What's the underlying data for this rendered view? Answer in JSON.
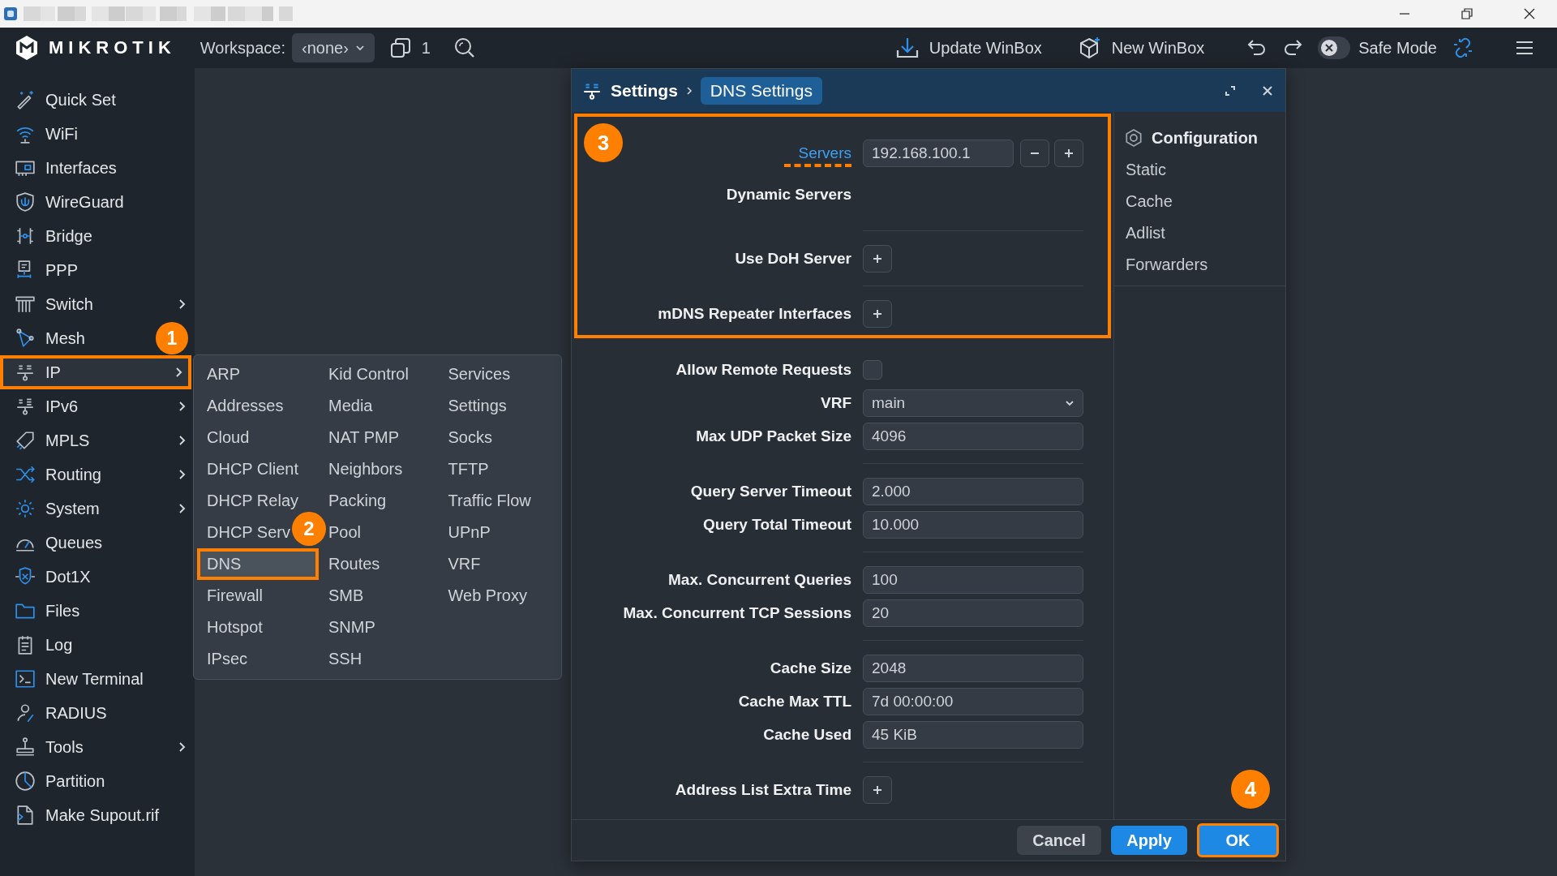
{
  "toolbar": {
    "brand": "MIKROTIK",
    "workspace_label": "Workspace:",
    "workspace_value": "‹none›",
    "window_count": "1",
    "update_button": "Update WinBox",
    "new_button": "New WinBox",
    "safe_mode": {
      "label": "Safe Mode",
      "on": false
    }
  },
  "sidebar": {
    "items": [
      {
        "label": "Quick Set",
        "submenu": false,
        "selected": false
      },
      {
        "label": "WiFi",
        "submenu": false,
        "selected": false
      },
      {
        "label": "Interfaces",
        "submenu": false,
        "selected": false
      },
      {
        "label": "WireGuard",
        "submenu": false,
        "selected": false
      },
      {
        "label": "Bridge",
        "submenu": false,
        "selected": false
      },
      {
        "label": "PPP",
        "submenu": false,
        "selected": false
      },
      {
        "label": "Switch",
        "submenu": true,
        "selected": false
      },
      {
        "label": "Mesh",
        "submenu": false,
        "selected": false
      },
      {
        "label": "IP",
        "submenu": true,
        "selected": true,
        "step": "1"
      },
      {
        "label": "IPv6",
        "submenu": true,
        "selected": false
      },
      {
        "label": "MPLS",
        "submenu": true,
        "selected": false
      },
      {
        "label": "Routing",
        "submenu": true,
        "selected": false
      },
      {
        "label": "System",
        "submenu": true,
        "selected": false
      },
      {
        "label": "Queues",
        "submenu": false,
        "selected": false
      },
      {
        "label": "Dot1X",
        "submenu": false,
        "selected": false
      },
      {
        "label": "Files",
        "submenu": false,
        "selected": false
      },
      {
        "label": "Log",
        "submenu": false,
        "selected": false
      },
      {
        "label": "New Terminal",
        "submenu": false,
        "selected": false
      },
      {
        "label": "RADIUS",
        "submenu": false,
        "selected": false
      },
      {
        "label": "Tools",
        "submenu": true,
        "selected": false
      },
      {
        "label": "Partition",
        "submenu": false,
        "selected": false
      },
      {
        "label": "Make Supout.rif",
        "submenu": false,
        "selected": false
      }
    ]
  },
  "menu": {
    "columns": [
      [
        {
          "label": "ARP",
          "selected": false
        },
        {
          "label": "Addresses",
          "selected": false
        },
        {
          "label": "Cloud",
          "selected": false
        },
        {
          "label": "DHCP Client",
          "selected": false
        },
        {
          "label": "DHCP Relay",
          "selected": false
        },
        {
          "label": "DHCP Serv",
          "selected": false
        },
        {
          "label": "DNS",
          "selected": true,
          "step": "2"
        },
        {
          "label": "Firewall",
          "selected": false
        },
        {
          "label": "Hotspot",
          "selected": false
        },
        {
          "label": "IPsec",
          "selected": false
        }
      ],
      [
        {
          "label": "Kid Control",
          "selected": false
        },
        {
          "label": "Media",
          "selected": false
        },
        {
          "label": "NAT PMP",
          "selected": false
        },
        {
          "label": "Neighbors",
          "selected": false
        },
        {
          "label": "Packing",
          "selected": false
        },
        {
          "label": "Pool",
          "selected": false
        },
        {
          "label": "Routes",
          "selected": false
        },
        {
          "label": "SMB",
          "selected": false
        },
        {
          "label": "SNMP",
          "selected": false
        },
        {
          "label": "SSH",
          "selected": false
        }
      ],
      [
        {
          "label": "Services",
          "selected": false
        },
        {
          "label": "Settings",
          "selected": false
        },
        {
          "label": "Socks",
          "selected": false
        },
        {
          "label": "TFTP",
          "selected": false
        },
        {
          "label": "Traffic Flow",
          "selected": false
        },
        {
          "label": "UPnP",
          "selected": false
        },
        {
          "label": "VRF",
          "selected": false
        },
        {
          "label": "Web Proxy",
          "selected": false
        }
      ]
    ]
  },
  "dialog": {
    "breadcrumb": [
      {
        "label": "Settings",
        "selected": false
      },
      {
        "label": "DNS Settings",
        "selected": true
      }
    ],
    "sections": [
      {
        "step": "3",
        "groups": [
          {
            "rows": [
              {
                "kind": "list",
                "label": "Servers",
                "emphasized": true,
                "value": "192.168.100.1"
              },
              {
                "kind": "info",
                "label": "Dynamic Servers",
                "emphasized": false
              }
            ]
          },
          {
            "rows": [
              {
                "kind": "add",
                "label": "Use DoH Server",
                "emphasized": false
              }
            ]
          },
          {
            "rows": [
              {
                "kind": "add",
                "label": "mDNS Repeater Interfaces",
                "emphasized": false
              }
            ]
          }
        ]
      },
      {
        "groups": [
          {
            "rows": [
              {
                "kind": "checkbox",
                "label": "Allow Remote Requests",
                "emphasized": false,
                "checked": false
              },
              {
                "kind": "select",
                "label": "VRF",
                "emphasized": false,
                "value": "main"
              },
              {
                "kind": "input",
                "label": "Max UDP Packet Size",
                "emphasized": false,
                "value": "4096"
              }
            ]
          },
          {
            "rows": [
              {
                "kind": "input",
                "label": "Query Server Timeout",
                "emphasized": false,
                "value": "2.000"
              },
              {
                "kind": "input",
                "label": "Query Total Timeout",
                "emphasized": false,
                "value": "10.000"
              }
            ]
          },
          {
            "rows": [
              {
                "kind": "input",
                "label": "Max. Concurrent Queries",
                "emphasized": false,
                "value": "100"
              },
              {
                "kind": "input",
                "label": "Max. Concurrent TCP Sessions",
                "emphasized": false,
                "value": "20"
              }
            ]
          },
          {
            "rows": [
              {
                "kind": "input",
                "label": "Cache Size",
                "emphasized": false,
                "value": "2048"
              },
              {
                "kind": "input",
                "label": "Cache Max TTL",
                "emphasized": false,
                "value": "7d 00:00:00"
              },
              {
                "kind": "input",
                "label": "Cache Used",
                "emphasized": false,
                "value": "45 KiB"
              }
            ]
          },
          {
            "rows": [
              {
                "kind": "add",
                "label": "Address List Extra Time",
                "emphasized": false
              }
            ]
          }
        ]
      }
    ],
    "side_panel": {
      "title": "Configuration",
      "items": [
        {
          "label": "Static",
          "selected": false
        },
        {
          "label": "Cache",
          "selected": false
        },
        {
          "label": "Adlist",
          "selected": false
        },
        {
          "label": "Forwarders",
          "selected": false
        }
      ]
    },
    "buttons": [
      {
        "label": "Cancel",
        "kind": "secondary"
      },
      {
        "label": "Apply",
        "kind": "primary"
      },
      {
        "label": "OK",
        "kind": "primary",
        "step": "4"
      }
    ]
  }
}
